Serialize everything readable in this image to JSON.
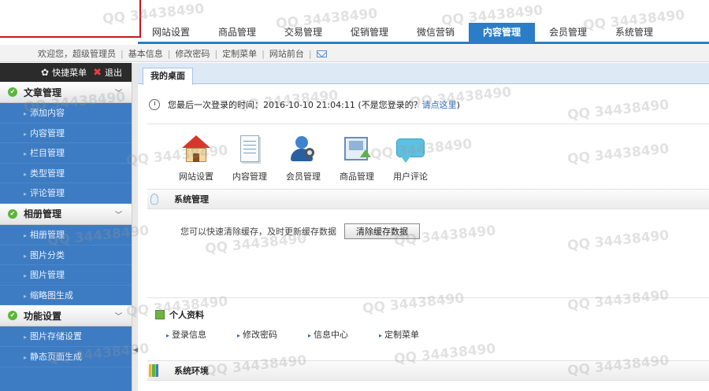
{
  "nav": {
    "tabs": [
      "网站设置",
      "商品管理",
      "交易管理",
      "促销管理",
      "微信营销",
      "内容管理",
      "会员管理",
      "系统管理"
    ],
    "active": "内容管理"
  },
  "subbar": {
    "links": [
      "欢迎您，超级管理员",
      "基本信息",
      "修改密码",
      "定制菜单",
      "网站前台"
    ],
    "mail_icon": "mail-icon"
  },
  "sidebar": {
    "quick_menu": "快捷菜单",
    "exit": "退出",
    "sections": [
      {
        "title": "文章管理",
        "items": [
          "添加内容",
          "内容管理",
          "栏目管理",
          "类型管理",
          "评论管理"
        ]
      },
      {
        "title": "相册管理",
        "items": [
          "相册管理",
          "图片分类",
          "图片管理",
          "缩略图生成"
        ]
      },
      {
        "title": "功能设置",
        "items": [
          "图片存储设置",
          "静态页面生成"
        ]
      }
    ]
  },
  "content": {
    "tab": "我的桌面",
    "login_prefix": "您最后一次登录的时间：2016-10-10 21:04:11 (不是您登录的？",
    "login_link": "请点这里",
    "login_suffix": ")",
    "shortcuts": [
      "网站设置",
      "内容管理",
      "会员管理",
      "商品管理",
      "用户评论"
    ],
    "system_title": "系统管理",
    "cache_text": "您可以快速清除缓存，及时更新缓存数据",
    "cache_button": "清除缓存数据",
    "profile_title": "个人资料",
    "profile_links": [
      "登录信息",
      "修改密码",
      "信息中心",
      "定制菜单"
    ],
    "env_title": "系统环境"
  },
  "watermark": "QQ 34438490",
  "colors": {
    "accent": "#2b7dc8",
    "sidebar": "#3d7cc2",
    "border_red": "#c8161d"
  }
}
